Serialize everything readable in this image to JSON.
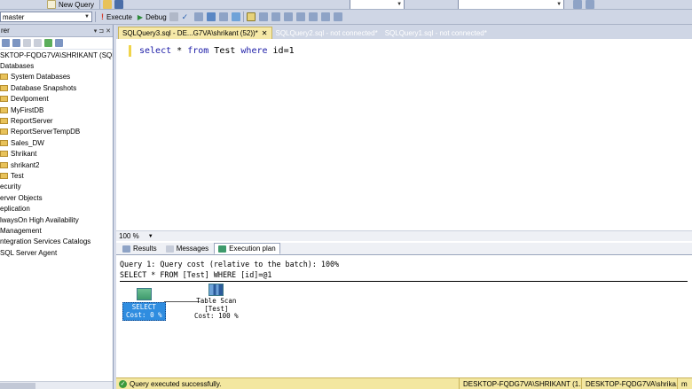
{
  "toolbar1": {
    "new_query_label": "New Query"
  },
  "toolbar2": {
    "database_value": "master",
    "execute_label": "Execute",
    "debug_label": "Debug"
  },
  "explorer": {
    "title": "rer",
    "server_node": "SKTOP-FQDG7VA\\SHRIKANT (SQL S",
    "items": [
      "Databases",
      "System Databases",
      "Database Snapshots",
      "Devlpoment",
      "MyFirstDB",
      "ReportServer",
      "ReportServerTempDB",
      "Sales_DW",
      "Shrikant",
      "shrikant2",
      "Test",
      "ecurity",
      "erver Objects",
      "eplication",
      "lwaysOn High Availability",
      "Management",
      "ntegration Services Catalogs",
      "SQL Server Agent"
    ]
  },
  "tabs": [
    "SQLQuery3.sql - DE...G7VA\\shrikant (52))*",
    "SQLQuery2.sql - not connected*",
    "SQLQuery1.sql - not connected*"
  ],
  "editor": {
    "kw_select": "select",
    "star": " * ",
    "kw_from": "from",
    "table": " Test ",
    "kw_where": "where",
    "cond": " id=1"
  },
  "zoom": "100 %",
  "result_tabs": [
    "Results",
    "Messages",
    "Execution plan"
  ],
  "plan": {
    "header_line1": "Query 1: Query cost (relative to the batch): 100%",
    "header_line2": "SELECT * FROM [Test] WHERE [id]=@1",
    "select_name": "SELECT",
    "select_cost": "Cost: 0 %",
    "scan_name": "Table Scan",
    "scan_table": "[Test]",
    "scan_cost": "Cost: 100 %"
  },
  "status": {
    "message": "Query executed successfully.",
    "server": "DESKTOP-FQDG7VA\\SHRIKANT (1...",
    "user": "DESKTOP-FQDG7VA\\shrika...",
    "db": "m"
  },
  "colors": {
    "active_tab": "#f6e9a8",
    "status_bar": "#f3e7a0",
    "select_node": "#2f8de0"
  }
}
